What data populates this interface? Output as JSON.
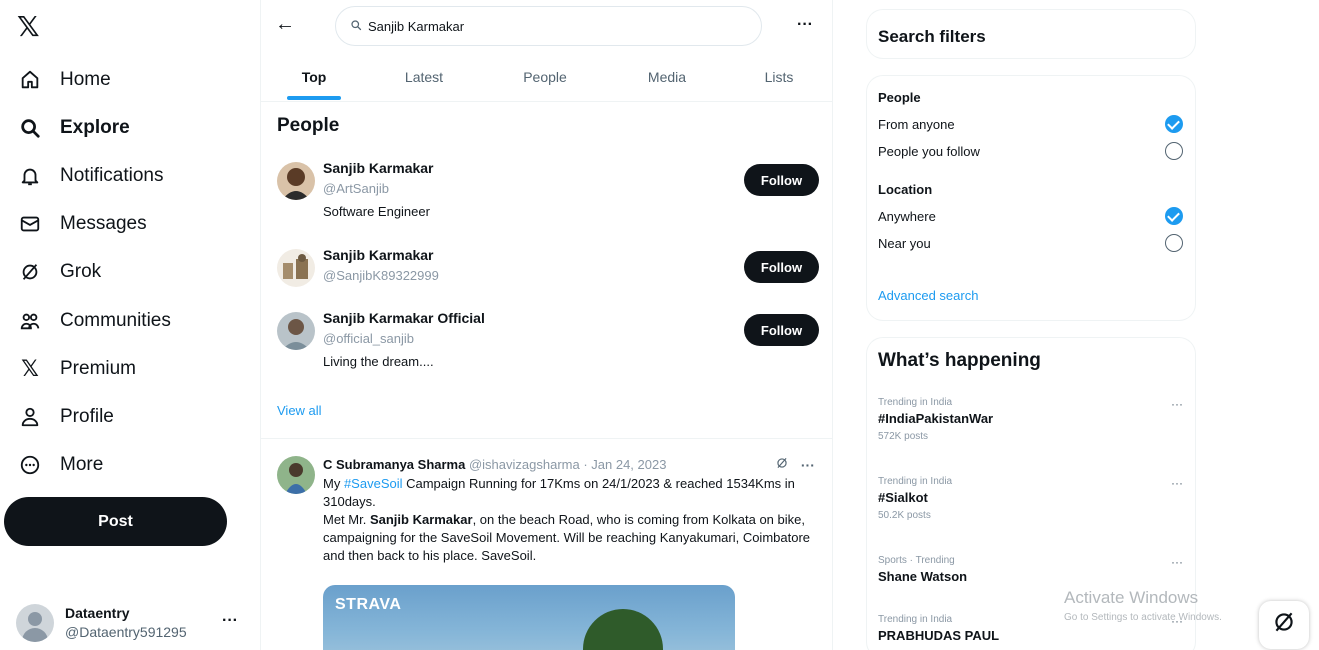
{
  "nav": {
    "items": [
      {
        "label": "Home",
        "icon": "home-icon"
      },
      {
        "label": "Explore",
        "icon": "search-icon"
      },
      {
        "label": "Notifications",
        "icon": "bell-icon"
      },
      {
        "label": "Messages",
        "icon": "envelope-icon"
      },
      {
        "label": "Grok",
        "icon": "grok-icon"
      },
      {
        "label": "Communities",
        "icon": "people-icon"
      },
      {
        "label": "Premium",
        "icon": "x-logo-icon"
      },
      {
        "label": "Profile",
        "icon": "person-icon"
      },
      {
        "label": "More",
        "icon": "more-circle-icon"
      }
    ],
    "active": "Explore",
    "post_label": "Post"
  },
  "account": {
    "name": "Dataentry",
    "handle": "@Dataentry591295"
  },
  "search": {
    "query": "Sanjib Karmakar"
  },
  "tabs": [
    "Top",
    "Latest",
    "People",
    "Media",
    "Lists"
  ],
  "active_tab": "Top",
  "people": {
    "title": "People",
    "items": [
      {
        "name": "Sanjib Karmakar",
        "handle": "@ArtSanjib",
        "bio": "Software Engineer",
        "follow": "Follow"
      },
      {
        "name": "Sanjib Karmakar",
        "handle": "@SanjibK89322999",
        "bio": "",
        "follow": "Follow"
      },
      {
        "name": "Sanjib Karmakar Official",
        "handle": "@official_sanjib",
        "bio": "Living the dream....",
        "follow": "Follow"
      }
    ],
    "view_all": "View all"
  },
  "tweet": {
    "name": "C Subramanya Sharma",
    "handle_date": "@ishavizagsharma · Jan 24, 2023",
    "text_before_hashtag": "My ",
    "hashtag": "#SaveSoil",
    "text_after_hashtag": " Campaign Running for 17Kms on 24/1/2023 & reached 1534Kms in 310days.",
    "text_line2_before": "Met Mr. ",
    "text_line2_bold": "Sanjib Karmakar",
    "text_line2_after": ", on the beach Road, who is coming from Kolkata on bike, campaigning for the SaveSoil Movement. Will be reaching Kanyakumari, Coimbatore and then back to his place. SaveSoil.",
    "media_label": "STRAVA"
  },
  "filters": {
    "title": "Search filters",
    "people_heading": "People",
    "people_options": [
      "From anyone",
      "People you follow"
    ],
    "people_selected": 0,
    "location_heading": "Location",
    "location_options": [
      "Anywhere",
      "Near you"
    ],
    "location_selected": 0,
    "advanced": "Advanced search"
  },
  "happening": {
    "title": "What’s happening",
    "trends": [
      {
        "context": "Trending in India",
        "topic": "#IndiaPakistanWar",
        "posts": "572K posts"
      },
      {
        "context": "Trending in India",
        "topic": "#Sialkot",
        "posts": "50.2K posts"
      },
      {
        "context": "Sports · Trending",
        "topic": "Shane Watson",
        "posts": ""
      },
      {
        "context": "Trending in India",
        "topic": "PRABHUDAS PAUL",
        "posts": ""
      }
    ]
  },
  "watermark": {
    "line1": "Activate Windows",
    "line2": "Go to Settings to activate Windows."
  },
  "colors": {
    "accent": "#1d9bf0",
    "text": "#0f1419",
    "muted": "#536471",
    "button": "#0f1419"
  }
}
